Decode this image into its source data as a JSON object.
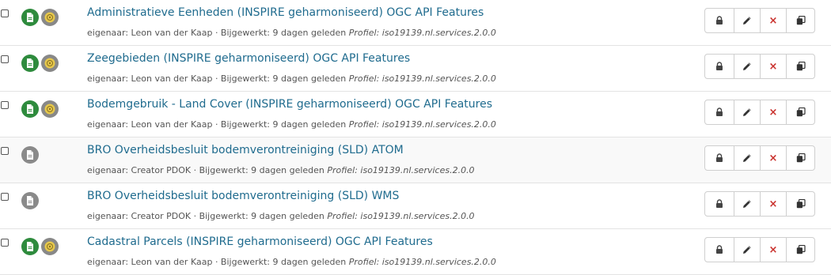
{
  "records": [
    {
      "title": "Administratieve Eenheden (INSPIRE geharmoniseerd) OGC API Features",
      "owner": "eigenaar: Leon van der Kaap",
      "updated": "· Bijgewerkt: 9 dagen geleden",
      "profile": "Profiel: iso19139.nl.services.2.0.0",
      "icons": [
        "document-icon",
        "inspire-icon"
      ]
    },
    {
      "title": "Zeegebieden (INSPIRE geharmoniseerd) OGC API Features",
      "owner": "eigenaar: Leon van der Kaap",
      "updated": "· Bijgewerkt: 9 dagen geleden",
      "profile": "Profiel: iso19139.nl.services.2.0.0",
      "icons": [
        "document-icon",
        "inspire-icon"
      ]
    },
    {
      "title": "Bodemgebruik - Land Cover (INSPIRE geharmoniseerd) OGC API Features",
      "owner": "eigenaar: Leon van der Kaap",
      "updated": "· Bijgewerkt: 9 dagen geleden",
      "profile": "Profiel: iso19139.nl.services.2.0.0",
      "icons": [
        "document-icon",
        "inspire-icon"
      ]
    },
    {
      "title": "BRO Overheidsbesluit bodemverontreiniging (SLD) ATOM",
      "owner": "eigenaar: Creator PDOK",
      "updated": "· Bijgewerkt: 9 dagen geleden",
      "profile": "Profiel: iso19139.nl.services.2.0.0",
      "icons": [
        "document-icon"
      ]
    },
    {
      "title": "BRO Overheidsbesluit bodemverontreiniging (SLD) WMS",
      "owner": "eigenaar: Creator PDOK",
      "updated": "· Bijgewerkt: 9 dagen geleden",
      "profile": "Profiel: iso19139.nl.services.2.0.0",
      "icons": [
        "document-icon"
      ]
    },
    {
      "title": "Cadastral Parcels (INSPIRE geharmoniseerd) OGC API Features",
      "owner": "eigenaar: Leon van der Kaap",
      "updated": "· Bijgewerkt: 9 dagen geleden",
      "profile": "Profiel: iso19139.nl.services.2.0.0",
      "icons": [
        "document-icon",
        "inspire-icon"
      ]
    }
  ],
  "actions": {
    "lock": "lock-icon",
    "edit": "pencil-icon",
    "delete": "×",
    "duplicate": "copy-icon"
  },
  "colors": {
    "link": "#1f6b8e",
    "valid_badge": "#2e8b3d",
    "neutral_badge": "#888888",
    "delete": "#c9302c"
  }
}
